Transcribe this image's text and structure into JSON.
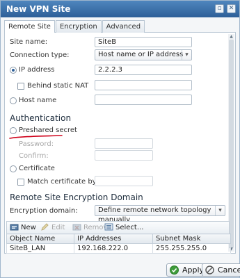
{
  "window": {
    "title": "New VPN Site"
  },
  "tabs": [
    {
      "label": "Remote Site",
      "active": true
    },
    {
      "label": "Encryption",
      "active": false
    },
    {
      "label": "Advanced",
      "active": false
    }
  ],
  "form": {
    "site_name_label": "Site name:",
    "site_name_value": "SiteB",
    "connection_type_label": "Connection type:",
    "connection_type_value": "Host name or IP address",
    "ip_address_label": "IP address",
    "ip_address_value": "2.2.2.3",
    "behind_nat_label": "Behind static NAT",
    "host_name_label": "Host name"
  },
  "authentication": {
    "heading": "Authentication",
    "preshared_label": "Preshared secret",
    "password_label": "Password:",
    "confirm_label": "Confirm:",
    "certificate_label": "Certificate",
    "match_dn_label": "Match certificate by DN"
  },
  "encryption_domain": {
    "heading": "Remote Site Encryption Domain",
    "domain_label": "Encryption domain:",
    "domain_value": "Define remote network topology manually",
    "toolbar": {
      "new_label": "New",
      "edit_label": "Edit",
      "remove_label": "Remove",
      "select_label": "Select..."
    },
    "columns": [
      "Object Name",
      "IP Addresses",
      "Subnet Mask"
    ],
    "rows": [
      [
        "SiteB_LAN",
        "192.168.222.0",
        "255.255.255.0"
      ]
    ]
  },
  "footer": {
    "apply_label": "Apply",
    "cancel_label": "Cancel"
  },
  "colors": {
    "annotation": "#d0021b",
    "accent": "#2d5f98"
  }
}
